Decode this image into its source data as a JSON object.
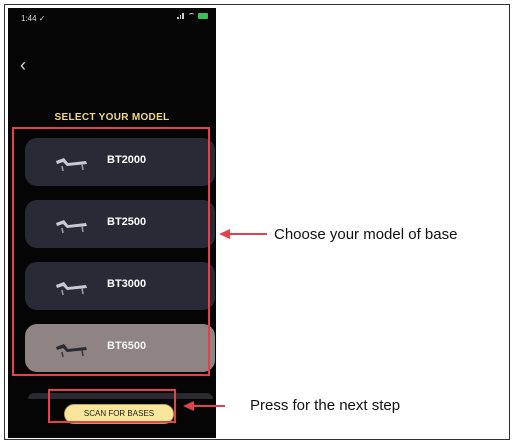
{
  "status_bar": {
    "time": "1:44 ✓"
  },
  "screen": {
    "title": "SELECT YOUR MODEL",
    "models": [
      {
        "label": "BT2000",
        "selected": false
      },
      {
        "label": "BT2500",
        "selected": false
      },
      {
        "label": "BT3000",
        "selected": false
      },
      {
        "label": "BT6500",
        "selected": true
      }
    ],
    "scan_button_label": "SCAN FOR BASES"
  },
  "annotations": {
    "model_hint": "Choose your model of base",
    "scan_hint": "Press for the next step"
  },
  "colors": {
    "highlight": "#e3424c",
    "card": "#2a2a36",
    "card_selected": "#8e8483",
    "title": "#f3d77b",
    "scan_button": "#f8e69a"
  },
  "icons": [
    "chevron-left-icon",
    "bed-icon",
    "signal-icon",
    "wifi-icon",
    "battery-icon"
  ]
}
